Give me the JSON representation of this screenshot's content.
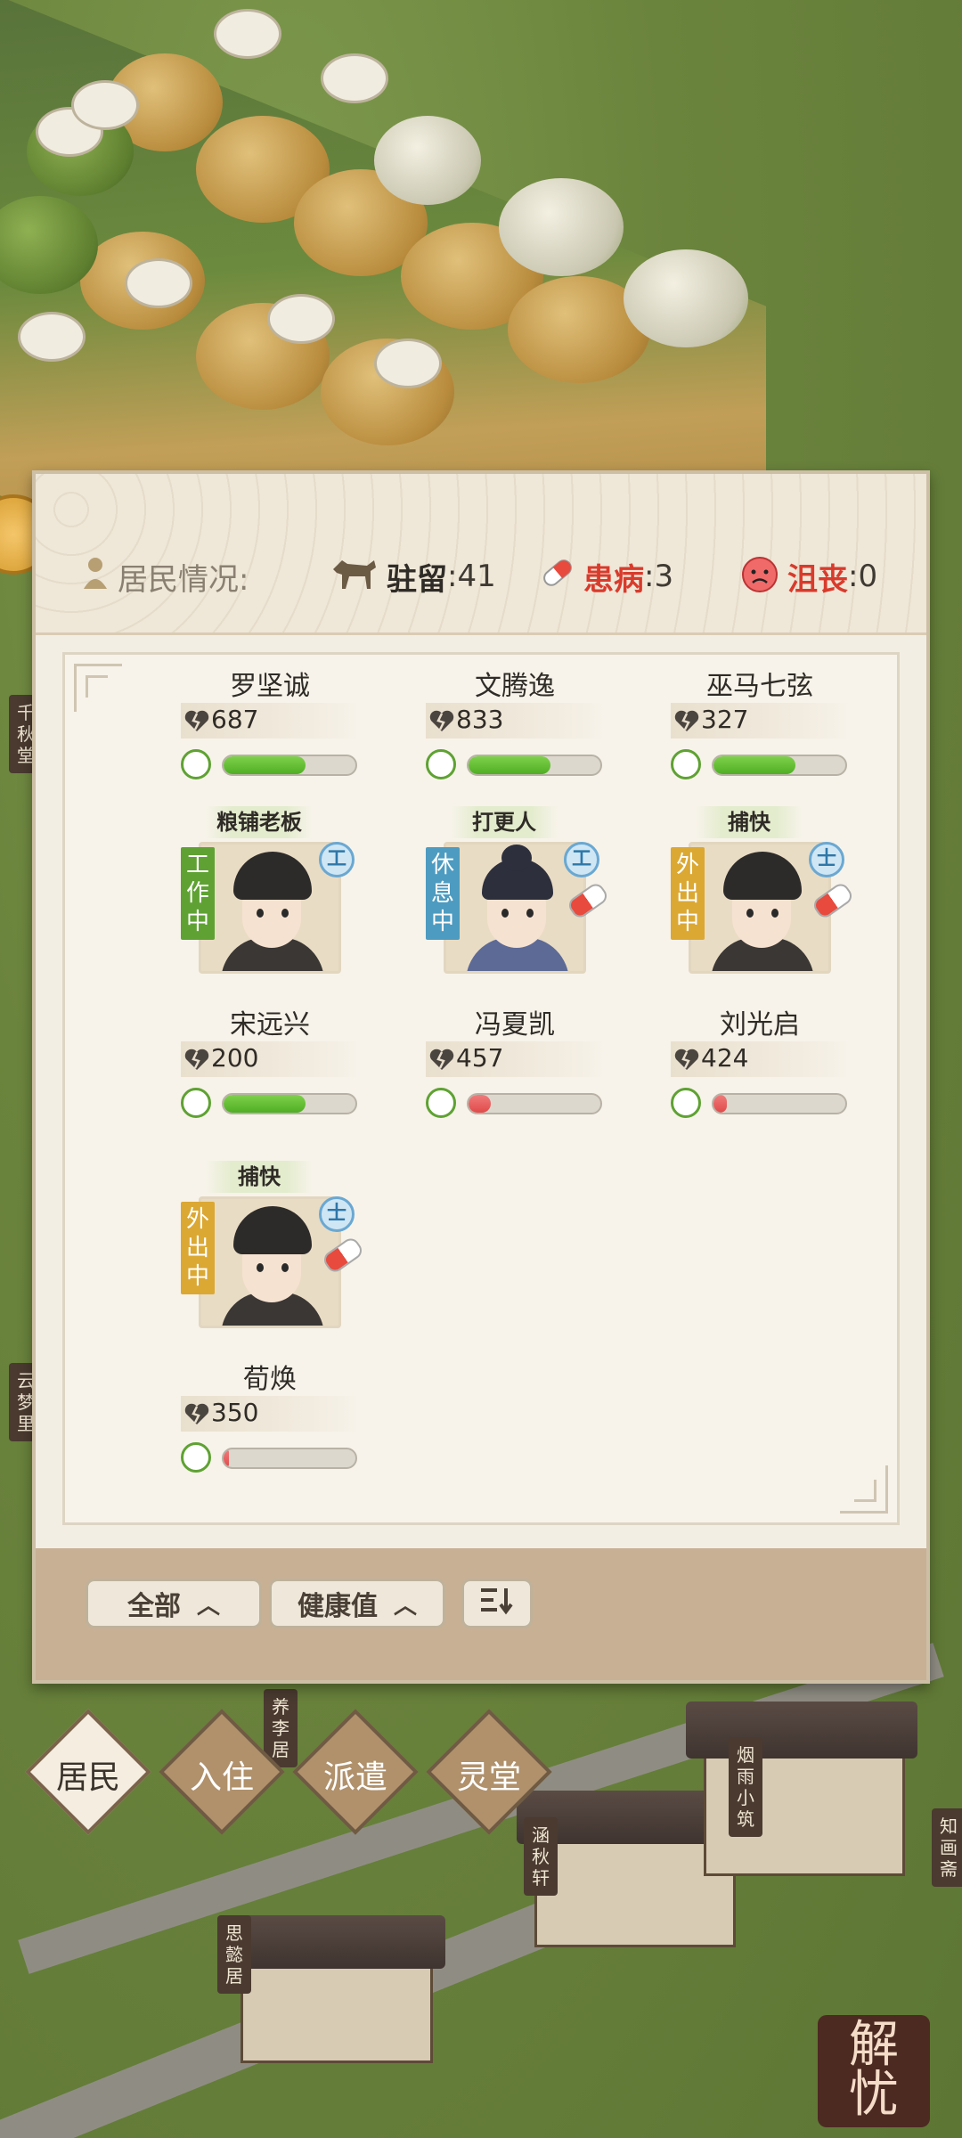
{
  "header": {
    "title_label": "居民情况:",
    "stay_label": "驻留",
    "stay_value": ":41",
    "sick_label": "患病",
    "sick_value": ":3",
    "sad_label": "沮丧",
    "sad_value": ":0"
  },
  "residents": [
    {
      "name": "罗坚诚",
      "coins": "687",
      "health": 0.62,
      "color": "#5fae24"
    },
    {
      "name": "文腾逸",
      "coins": "833",
      "health": 0.62,
      "color": "#5fae24"
    },
    {
      "name": "巫马七弦",
      "coins": "327",
      "health": 0.62,
      "color": "#5fae24"
    },
    {
      "name": "宋远兴",
      "coins": "200",
      "health": 0.62,
      "job": "粮铺老板",
      "state": "工作中",
      "badge": "工",
      "sick": false
    },
    {
      "name": "冯夏凯",
      "coins": "457",
      "health": 0.17,
      "job": "打更人",
      "state": "休息中",
      "badge": "工",
      "sick": true
    },
    {
      "name": "刘光启",
      "coins": "424",
      "health": 0.1,
      "job": "捕快",
      "state": "外出中",
      "badge": "士",
      "sick": true
    },
    {
      "name": "荀焕",
      "coins": "350",
      "health": 0.04,
      "job": "捕快",
      "state": "外出中",
      "badge": "士",
      "sick": true
    }
  ],
  "filters": {
    "all_label": "全部",
    "health_label": "健康值",
    "sort_icon": "sort-icon"
  },
  "tabs": [
    {
      "label": "居民",
      "active": true
    },
    {
      "label": "入住",
      "active": false
    },
    {
      "label": "派遣",
      "active": false
    },
    {
      "label": "灵堂",
      "active": false
    }
  ],
  "scene": {
    "signs": [
      "烟雨小筑",
      "涵秋轩",
      "思懿居",
      "知画斋",
      "千秋堂",
      "云梦里",
      "养李居"
    ],
    "seal_text": [
      "解",
      "忧"
    ]
  }
}
